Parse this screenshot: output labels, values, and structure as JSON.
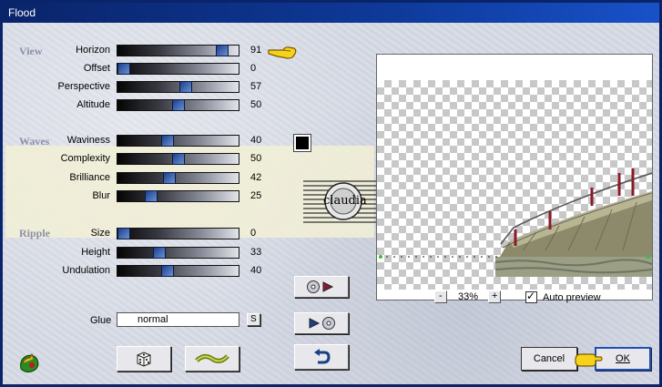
{
  "window": {
    "title": "Flood"
  },
  "sections": {
    "view": "View",
    "waves": "Waves",
    "ripple": "Ripple"
  },
  "sliders": {
    "horizon": {
      "label": "Horizon",
      "value": "91",
      "fraction": 0.91
    },
    "offset": {
      "label": "Offset",
      "value": "0",
      "fraction": 0.0
    },
    "perspective": {
      "label": "Perspective",
      "value": "57",
      "fraction": 0.57
    },
    "altitude": {
      "label": "Altitude",
      "value": "50",
      "fraction": 0.5
    },
    "waviness": {
      "label": "Waviness",
      "value": "40",
      "fraction": 0.4
    },
    "complexity": {
      "label": "Complexity",
      "value": "50",
      "fraction": 0.5
    },
    "brilliance": {
      "label": "Brilliance",
      "value": "42",
      "fraction": 0.42
    },
    "blur": {
      "label": "Blur",
      "value": "25",
      "fraction": 0.25
    },
    "size": {
      "label": "Size",
      "value": "0",
      "fraction": 0.0
    },
    "height": {
      "label": "Height",
      "value": "33",
      "fraction": 0.33
    },
    "undulation": {
      "label": "Undulation",
      "value": "40",
      "fraction": 0.4
    }
  },
  "glue": {
    "label": "Glue",
    "value": "normal",
    "button": "S"
  },
  "watermark": {
    "text": "claudia"
  },
  "zoom": {
    "minus": "-",
    "value": "33%",
    "plus": "+"
  },
  "auto_preview": {
    "label": "Auto preview",
    "checked": true
  },
  "buttons": {
    "cancel": "Cancel",
    "ok": "OK"
  },
  "colors": {
    "wave_color": "#000000",
    "titlebar": "#0a246a",
    "waves_band": "#f2f0d6"
  }
}
